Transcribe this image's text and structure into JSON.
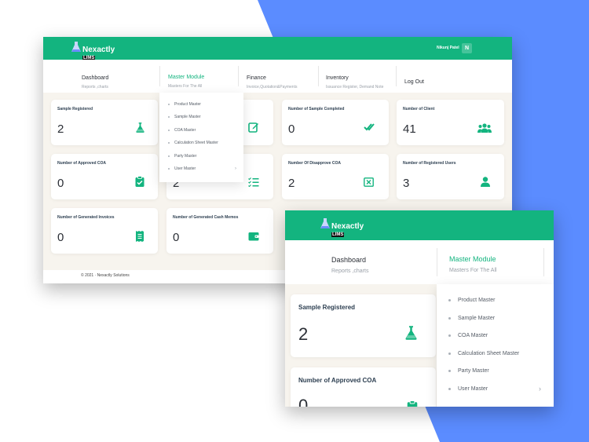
{
  "brand": {
    "name": "Nexactly",
    "sub": "LIMS"
  },
  "user": {
    "name": "Nikunj Patel",
    "initial": "N"
  },
  "nav": [
    {
      "title": "Dashboard",
      "sub": "Reports ,charts"
    },
    {
      "title": "Master Module",
      "sub": "Masters For The All"
    },
    {
      "title": "Finance",
      "sub": "Invoice,Quotation&Payments"
    },
    {
      "title": "Inventory",
      "sub": "Issuance Register, Demand Note"
    },
    {
      "title": "Log Out",
      "sub": ""
    }
  ],
  "master_menu": [
    "Product Master",
    "Sample Master",
    "COA Master",
    "Calculation Sheet Master",
    "Party Master",
    "User Master"
  ],
  "cards": [
    {
      "title": "Sample Registered",
      "value": "2",
      "icon": "flask-icon"
    },
    {
      "title": "",
      "value": "",
      "icon": "edit-icon"
    },
    {
      "title": "Number of Sample Completed",
      "value": "0",
      "icon": "double-check-icon"
    },
    {
      "title": "Number of Client",
      "value": "41",
      "icon": "users-icon"
    },
    {
      "title": "Number of Approved COA",
      "value": "0",
      "icon": "clipboard-check-icon"
    },
    {
      "title": "",
      "value": "2",
      "icon": "checklist-icon"
    },
    {
      "title": "Number Of Disapprove COA",
      "value": "2",
      "icon": "x-square-icon"
    },
    {
      "title": "Number of Registered Users",
      "value": "3",
      "icon": "user-icon"
    },
    {
      "title": "Number of Generated Invoices",
      "value": "0",
      "icon": "receipt-icon"
    },
    {
      "title": "Number of Generated Cash Memos",
      "value": "0",
      "icon": "wallet-icon"
    }
  ],
  "footer": {
    "text": "© 2021 · Nexactly Solutions"
  },
  "colors": {
    "primary": "#13b47f",
    "background_blue": "#5b8cff"
  }
}
